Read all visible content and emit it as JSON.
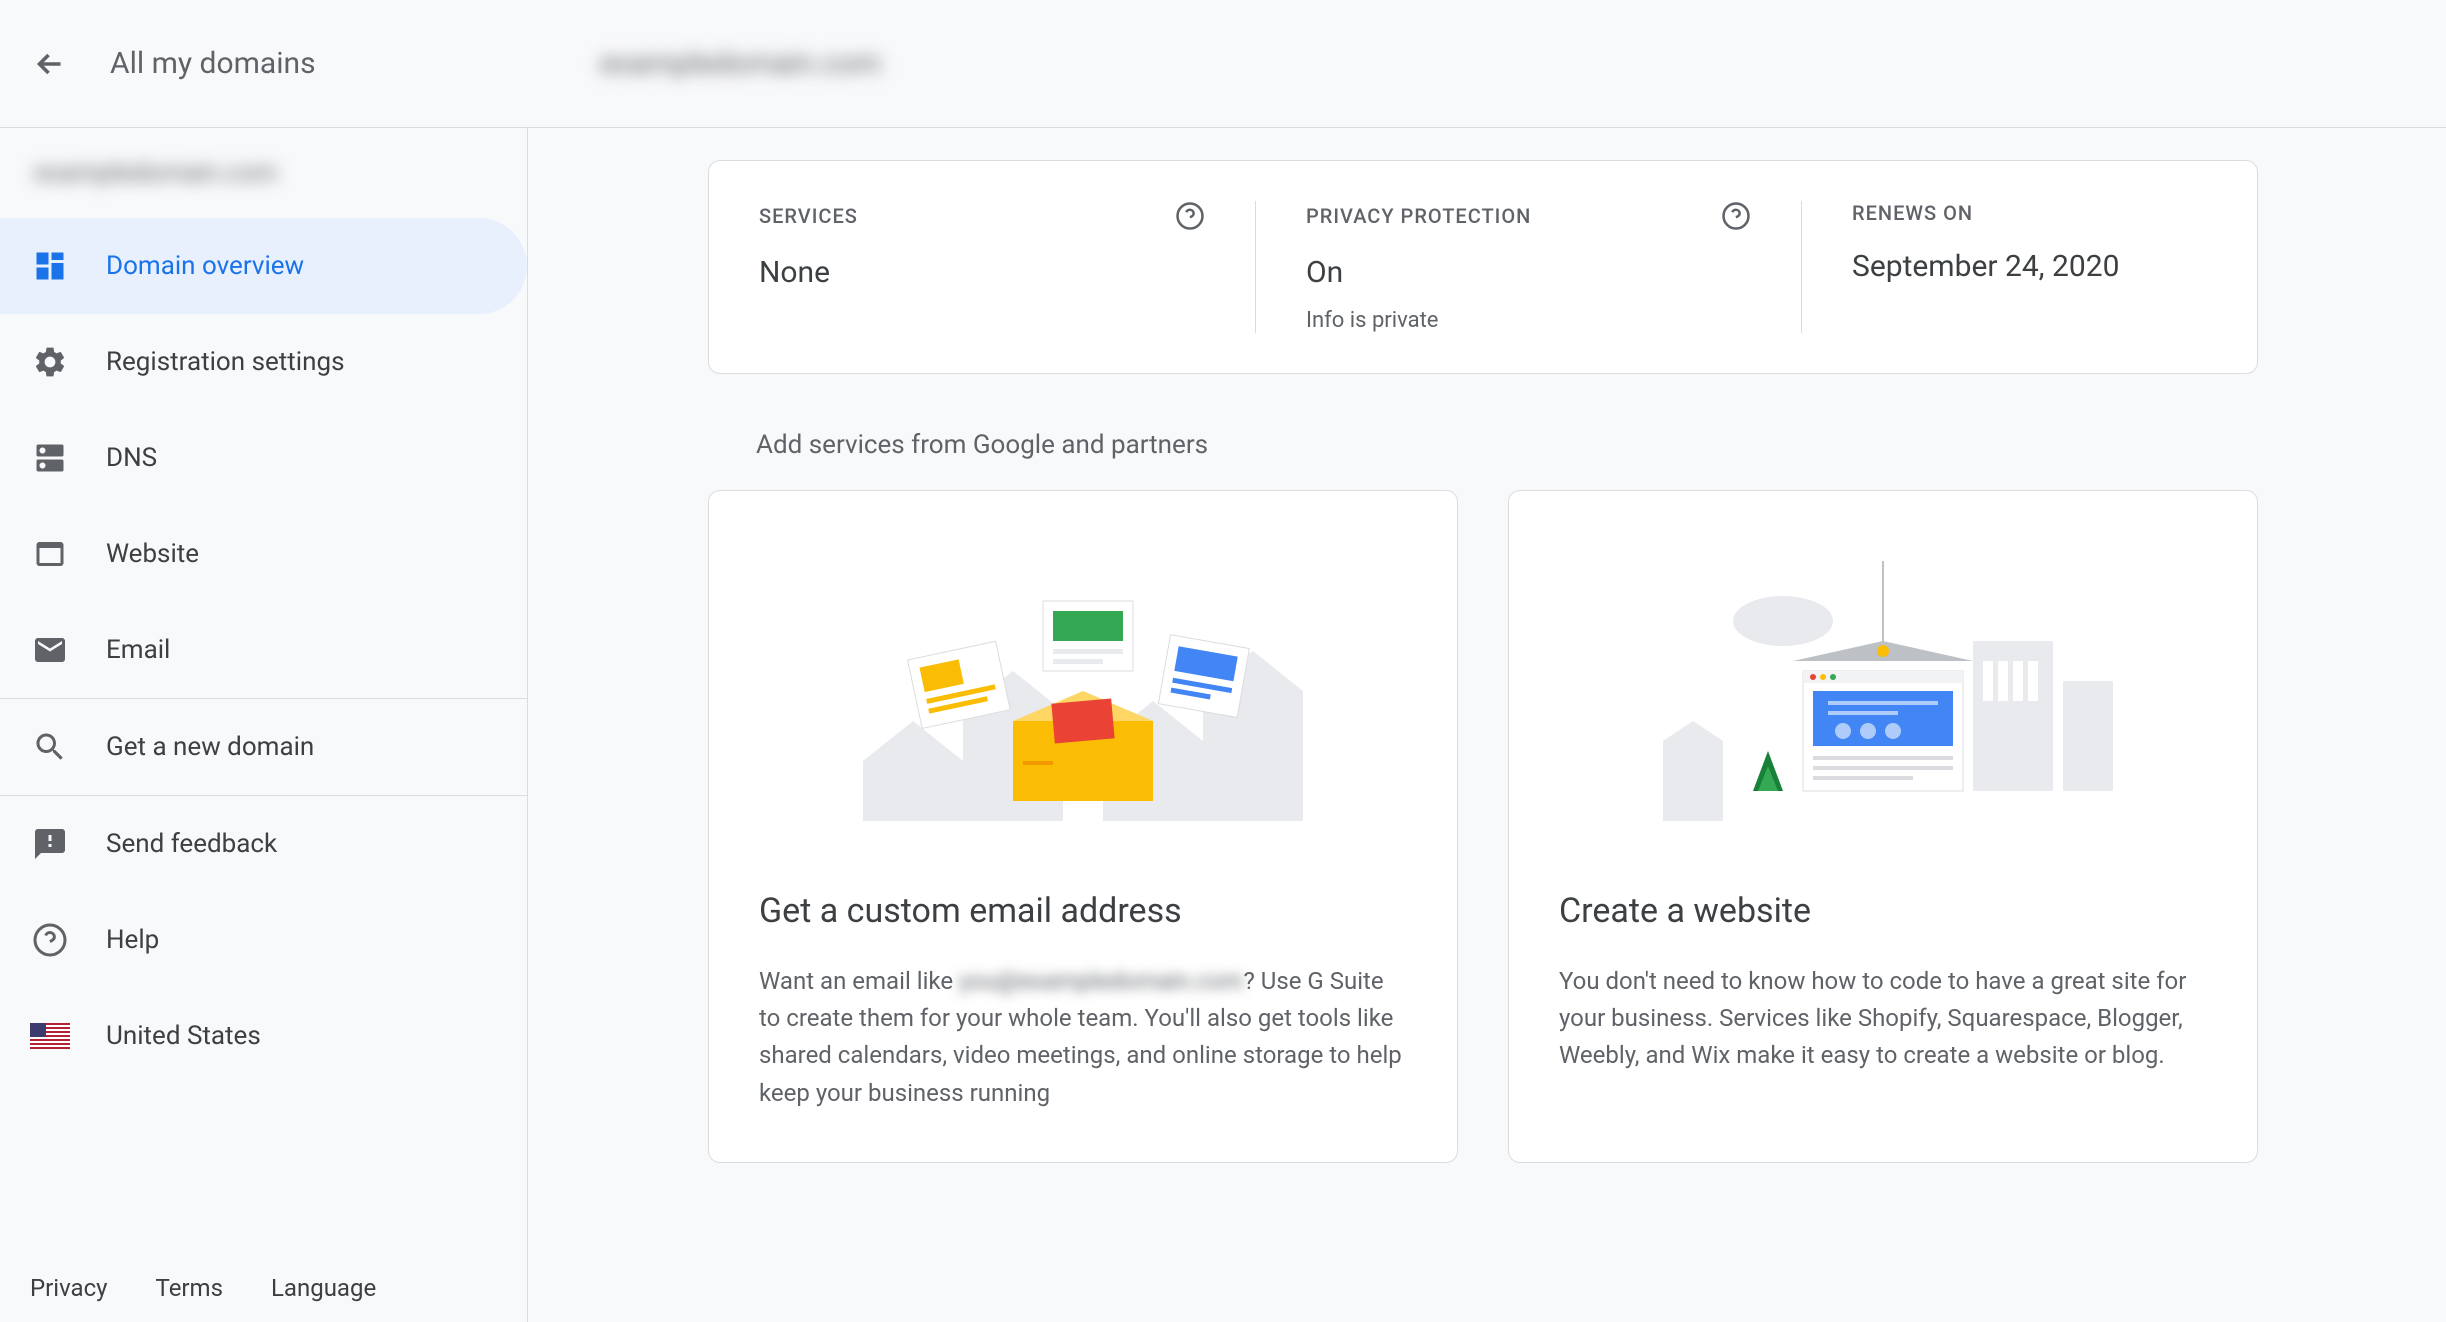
{
  "header": {
    "back_label": "All my domains",
    "domain_name": "exampledomain.com"
  },
  "sidebar": {
    "domain_name": "exampledomain.com",
    "items": [
      {
        "label": "Domain overview",
        "active": true
      },
      {
        "label": "Registration settings",
        "active": false
      },
      {
        "label": "DNS",
        "active": false
      },
      {
        "label": "Website",
        "active": false
      },
      {
        "label": "Email",
        "active": false
      }
    ],
    "get_new_domain": "Get a new domain",
    "send_feedback": "Send feedback",
    "help": "Help",
    "region": "United States"
  },
  "footer": {
    "privacy": "Privacy",
    "terms": "Terms",
    "language": "Language"
  },
  "summary": {
    "services": {
      "label": "SERVICES",
      "value": "None"
    },
    "privacy": {
      "label": "PRIVACY PROTECTION",
      "value": "On",
      "sub": "Info is private"
    },
    "renews": {
      "label": "RENEWS ON",
      "value": "September 24, 2020"
    }
  },
  "section_title": "Add services from Google and partners",
  "cards": {
    "email": {
      "title": "Get a custom email address",
      "body_prefix": "Want an email like ",
      "body_blur": "you@exampledomain.com",
      "body_suffix": "? Use G Suite to create them for your whole team. You'll also get tools like shared calendars, video meetings, and online storage to help keep your business running"
    },
    "website": {
      "title": "Create a website",
      "body": "You don't need to know how to code to have a great site for your business. Services like Shopify, Squarespace, Blogger, Weebly, and Wix make it easy to create a website or blog."
    }
  }
}
